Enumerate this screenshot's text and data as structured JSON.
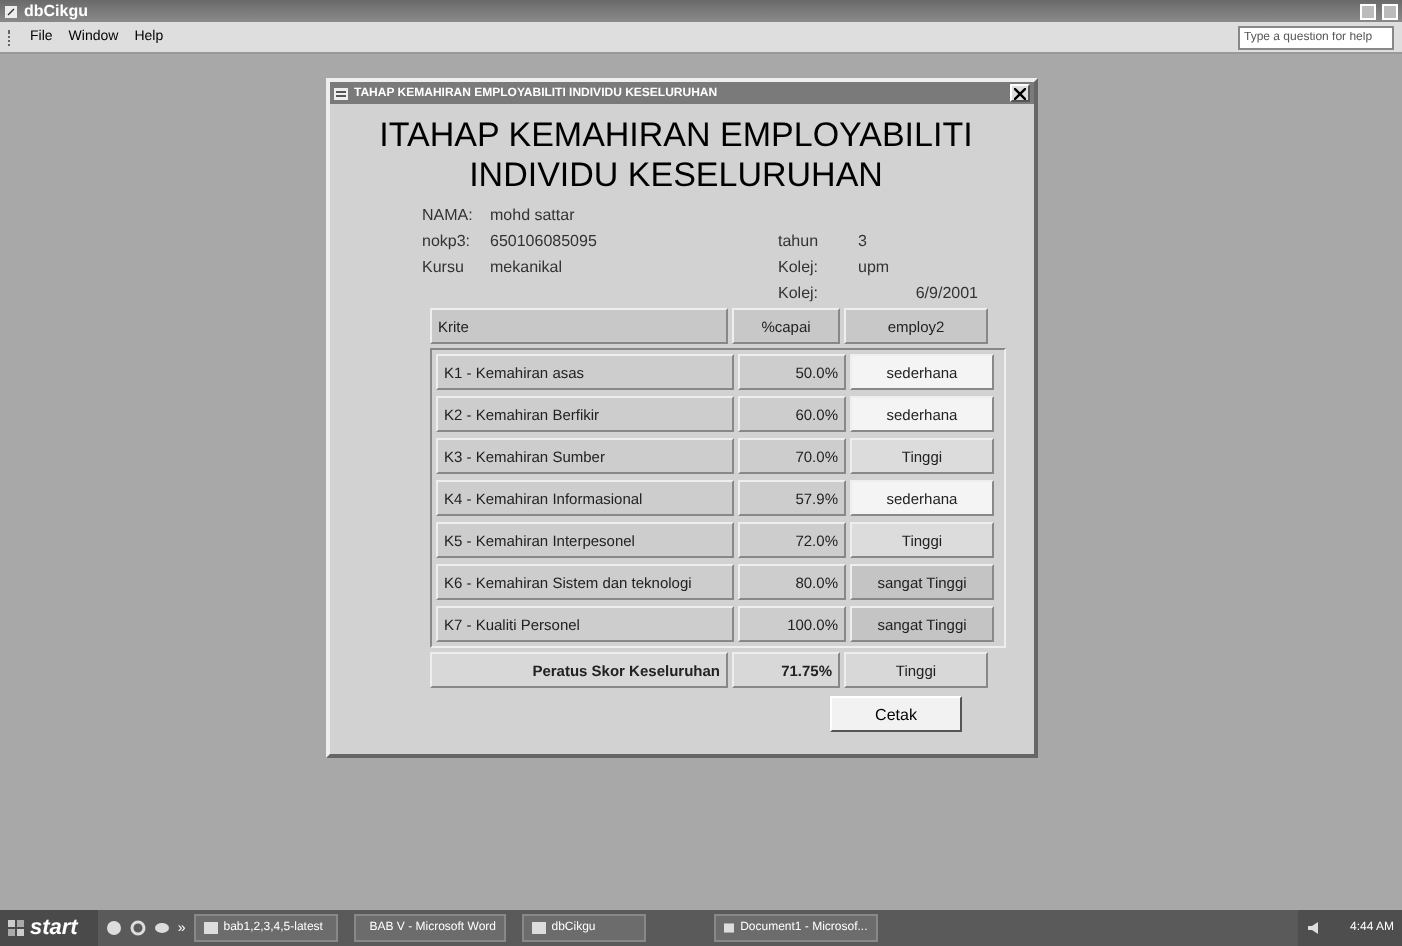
{
  "window": {
    "title": "dbCikgu"
  },
  "menu": [
    "File",
    "Window",
    "Help"
  ],
  "help_box": {
    "placeholder": "Type a question for help"
  },
  "dialog": {
    "title": "TAHAP KEMAHIRAN EMPLOYABILITI INDIVIDU KESELURUHAN",
    "heading": [
      "ITAHAP KEMAHIRAN EMPLOYABILITI",
      "INDIVIDU KESELURUHAN"
    ],
    "fields_left": [
      {
        "label": "NAMA:",
        "value": "mohd sattar"
      },
      {
        "label": "nokp3:",
        "value": "650106085095"
      },
      {
        "label": "Kursu",
        "value": "mekanikal"
      }
    ],
    "fields_right": [
      {
        "label": "tahun",
        "value": "3"
      },
      {
        "label": "Kolej:",
        "value": "upm"
      },
      {
        "label": "Kolej:",
        "value": "6/9/2001"
      }
    ],
    "table": {
      "columns": [
        "Krite",
        "%capai",
        "employ2"
      ],
      "rows": [
        {
          "krite": "K1 - Kemahiran asas",
          "capai": "50.0%",
          "employ": "sederhana",
          "color": "#f4f4f4"
        },
        {
          "krite": "K2 - Kemahiran Berfikir",
          "capai": "60.0%",
          "employ": "sederhana",
          "color": "#f4f4f4"
        },
        {
          "krite": "K3 - Kemahiran Sumber",
          "capai": "70.0%",
          "employ": "Tinggi",
          "color": "#dcdcdc"
        },
        {
          "krite": "K4 - Kemahiran Informasional",
          "capai": "57.9%",
          "employ": "sederhana",
          "color": "#f4f4f4"
        },
        {
          "krite": "K5 - Kemahiran Interpesonel",
          "capai": "72.0%",
          "employ": "Tinggi",
          "color": "#dcdcdc"
        },
        {
          "krite": "K6 - Kemahiran Sistem dan teknologi",
          "capai": "80.0%",
          "employ": "sangat Tinggi",
          "color": "#c4c4c4"
        },
        {
          "krite": "K7 - Kualiti Personel",
          "capai": "100.0%",
          "employ": "sangat Tinggi",
          "color": "#c4c4c4"
        }
      ],
      "total": {
        "label": "Peratus Skor Keseluruhan",
        "capai": "71.75%",
        "employ": "Tinggi"
      }
    },
    "button": "Cetak"
  },
  "taskbar": {
    "start": "start",
    "more": "»",
    "items": [
      "bab1,2,3,4,5-latest",
      "BAB V - Microsoft Word",
      "dbCikgu",
      "Document1 - Microsof..."
    ],
    "clock": "4:44 AM"
  }
}
